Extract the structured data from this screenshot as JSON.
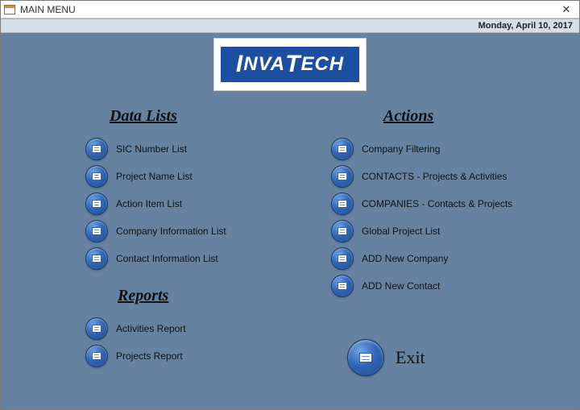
{
  "window": {
    "title": "MAIN MENU",
    "date": "Monday, April 10, 2017",
    "close_glyph": "✕"
  },
  "logo": {
    "text_prefix_cap": "I",
    "text_rest1": "NVA",
    "text_mid_cap": "T",
    "text_rest2": "ECH"
  },
  "sections": {
    "data_lists_title": "Data Lists",
    "reports_title": "Reports",
    "actions_title": "Actions"
  },
  "data_lists": [
    {
      "label": "SIC Number List"
    },
    {
      "label": "Project Name List"
    },
    {
      "label": "Action Item List"
    },
    {
      "label": "Company Information List"
    },
    {
      "label": "Contact Information List"
    }
  ],
  "reports": [
    {
      "label": "Activities Report"
    },
    {
      "label": "Projects Report"
    }
  ],
  "actions": [
    {
      "label": "Company Filtering"
    },
    {
      "label": "CONTACTS - Projects & Activities"
    },
    {
      "label": "COMPANIES - Contacts & Projects"
    },
    {
      "label": "Global Project List"
    },
    {
      "label": "ADD New Company"
    },
    {
      "label": "ADD New Contact"
    }
  ],
  "exit": {
    "label": "Exit"
  }
}
